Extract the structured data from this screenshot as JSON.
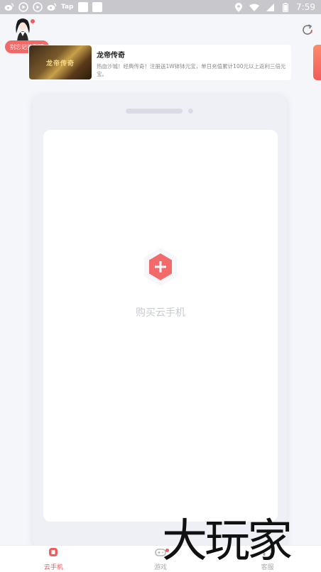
{
  "status_bar": {
    "left_icons": [
      "weibo-icon",
      "play-icon",
      "play-icon",
      "weibo-icon"
    ],
    "tap_label": "Tap",
    "time": "7:59"
  },
  "header": {
    "sign_badge": "别忘记签到哦"
  },
  "banner": {
    "image_text": "龙帝传奇",
    "title": "龙帝传奇",
    "description": "热血沙城！经典传奇！注册送1W钵钵元宝，单日充值累计100元以上返利三倍元宝。"
  },
  "phone": {
    "buy_label": "购买云手机"
  },
  "nav": {
    "items": [
      {
        "label": "云手机",
        "icon": "cloud-phone-icon"
      },
      {
        "label": "游戏",
        "icon": "gamepad-icon"
      },
      {
        "label": "客服",
        "icon": "headset-icon"
      }
    ]
  },
  "watermark": {
    "text": "大玩家"
  },
  "colors": {
    "accent": "#f25b5b",
    "status_bar": "#c8c8cc",
    "background": "#f5f6fa"
  }
}
